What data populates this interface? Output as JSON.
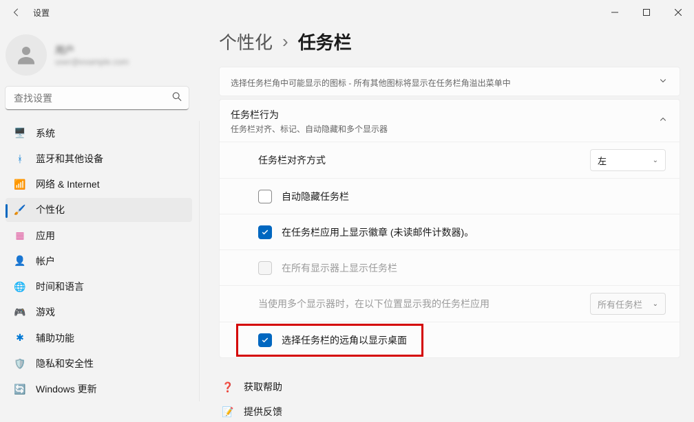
{
  "window": {
    "title": "设置"
  },
  "user": {
    "name": "用户",
    "email": "user@example.com"
  },
  "search": {
    "placeholder": "查找设置"
  },
  "sidebar": {
    "items": [
      {
        "label": "系统",
        "icon": "🖥️",
        "color": "ic-blue"
      },
      {
        "label": "蓝牙和其他设备",
        "icon": "ᚼ",
        "color": "ic-blue"
      },
      {
        "label": "网络 & Internet",
        "icon": "📶",
        "color": "ic-teal"
      },
      {
        "label": "个性化",
        "icon": "🖌️",
        "color": "ic-orange",
        "selected": true
      },
      {
        "label": "应用",
        "icon": "▦",
        "color": "ic-pink"
      },
      {
        "label": "帐户",
        "icon": "👤",
        "color": "ic-green"
      },
      {
        "label": "时间和语言",
        "icon": "🌐",
        "color": "ic-teal"
      },
      {
        "label": "游戏",
        "icon": "🎮",
        "color": "ic-gray"
      },
      {
        "label": "辅助功能",
        "icon": "✱",
        "color": "ic-blue"
      },
      {
        "label": "隐私和安全性",
        "icon": "🛡️",
        "color": "ic-gray"
      },
      {
        "label": "Windows 更新",
        "icon": "🔄",
        "color": "ic-teal"
      }
    ]
  },
  "breadcrumb": {
    "parent": "个性化",
    "sep": "›",
    "current": "任务栏"
  },
  "corner_card": {
    "sub": "选择任务栏角中可能显示的图标 - 所有其他图标将显示在任务栏角溢出菜单中"
  },
  "behavior_card": {
    "title": "任务栏行为",
    "sub": "任务栏对齐、标记、自动隐藏和多个显示器",
    "alignment": {
      "label": "任务栏对齐方式",
      "value": "左"
    },
    "auto_hide": {
      "label": "自动隐藏任务栏",
      "checked": false
    },
    "badges": {
      "label": "在任务栏应用上显示徽章 (未读邮件计数器)。",
      "checked": true
    },
    "all_displays": {
      "label": "在所有显示器上显示任务栏",
      "checked": false,
      "disabled": true
    },
    "multi_display_pos": {
      "label": "当使用多个显示器时，在以下位置显示我的任务栏应用",
      "value": "所有任务栏",
      "disabled": true
    },
    "far_corner": {
      "label": "选择任务栏的远角以显示桌面",
      "checked": true
    }
  },
  "footer": {
    "help": "获取帮助",
    "feedback": "提供反馈"
  }
}
